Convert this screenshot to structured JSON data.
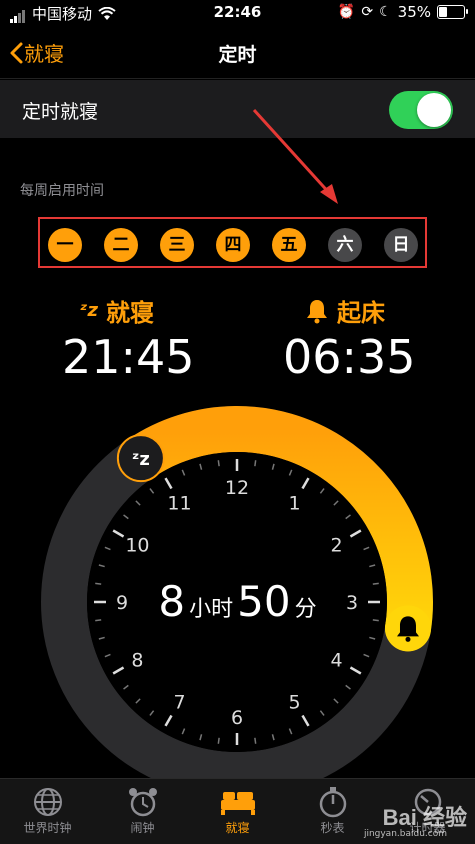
{
  "status_bar": {
    "carrier": "中国移动",
    "time": "22:46",
    "battery": "35%",
    "battery_level": 0.35
  },
  "nav": {
    "back_label": "就寝",
    "title": "定时"
  },
  "schedule_toggle": {
    "label": "定时就寝",
    "on": true
  },
  "weekly": {
    "label": "每周启用时间",
    "days": [
      {
        "label": "一",
        "active": true
      },
      {
        "label": "二",
        "active": true
      },
      {
        "label": "三",
        "active": true
      },
      {
        "label": "四",
        "active": true
      },
      {
        "label": "五",
        "active": true
      },
      {
        "label": "六",
        "active": false
      },
      {
        "label": "日",
        "active": false
      }
    ]
  },
  "bedtime": {
    "label": "就寝",
    "time": "21:45"
  },
  "wake": {
    "label": "起床",
    "time": "06:35"
  },
  "dial": {
    "hours_value": "8",
    "hours_unit": "小时",
    "minutes_value": "50",
    "minutes_unit": "分",
    "numbers": [
      "12",
      "1",
      "2",
      "3",
      "4",
      "5",
      "6",
      "7",
      "8",
      "9",
      "10",
      "11"
    ]
  },
  "tabs": [
    {
      "label": "世界时钟",
      "icon": "globe-icon",
      "active": false
    },
    {
      "label": "闹钟",
      "icon": "alarm-clock-icon",
      "active": false
    },
    {
      "label": "就寝",
      "icon": "bed-icon",
      "active": true
    },
    {
      "label": "秒表",
      "icon": "stopwatch-icon",
      "active": false
    },
    {
      "label": "计时器",
      "icon": "timer-icon",
      "active": false
    }
  ],
  "watermark": {
    "text": "Bai 经验",
    "sub": "jingyan.baidu.com"
  },
  "colors": {
    "accent": "#ff9f0a",
    "toggle_on": "#30d158",
    "annotation": "#e53935"
  }
}
